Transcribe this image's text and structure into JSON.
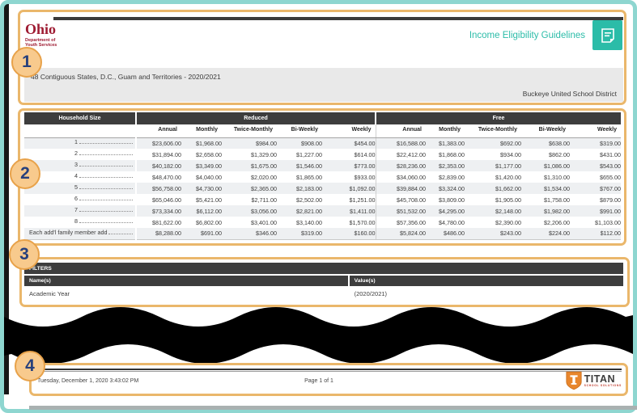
{
  "colors": {
    "teal_accent": "#2bbca8",
    "header_bar": "#3d3d3d",
    "frame_border": "#8ed6d0",
    "annotation_border": "#eab76b",
    "annotation_circle_fill": "#f8ca8d",
    "annotation_number": "#27407c",
    "ohio_red": "#9e1b32",
    "titan_orange": "#e8862d",
    "titan_sub_red": "#c0392b",
    "row_stripe": "#eef0f2"
  },
  "icons": {
    "report_icon": "document-icon",
    "brand_icon": "shield-icon"
  },
  "header": {
    "logo_title": "Ohio",
    "logo_sub1": "Department of",
    "logo_sub2": "Youth Services",
    "report_title": "Income Eligibility Guidelines",
    "region_line": "48 Contiguous States, D.C., Guam and Territories - 2020/2021",
    "district": "Buckeye United School District"
  },
  "table": {
    "household_header": "Household Size",
    "group_headers": [
      "Reduced",
      "Free"
    ],
    "sub_headers": [
      "Annual",
      "Monthly",
      "Twice-Monthly",
      "Bi-Weekly",
      "Weekly"
    ],
    "rows": [
      {
        "label": "1",
        "values": [
          "$23,606.00",
          "$1,968.00",
          "$984.00",
          "$908.00",
          "$454.00",
          "$16,588.00",
          "$1,383.00",
          "$692.00",
          "$638.00",
          "$319.00"
        ]
      },
      {
        "label": "2",
        "values": [
          "$31,894.00",
          "$2,658.00",
          "$1,329.00",
          "$1,227.00",
          "$614.00",
          "$22,412.00",
          "$1,868.00",
          "$934.00",
          "$862.00",
          "$431.00"
        ]
      },
      {
        "label": "3",
        "values": [
          "$40,182.00",
          "$3,349.00",
          "$1,675.00",
          "$1,546.00",
          "$773.00",
          "$28,236.00",
          "$2,353.00",
          "$1,177.00",
          "$1,086.00",
          "$543.00"
        ]
      },
      {
        "label": "4",
        "values": [
          "$48,470.00",
          "$4,040.00",
          "$2,020.00",
          "$1,865.00",
          "$933.00",
          "$34,060.00",
          "$2,839.00",
          "$1,420.00",
          "$1,310.00",
          "$655.00"
        ]
      },
      {
        "label": "5",
        "values": [
          "$56,758.00",
          "$4,730.00",
          "$2,365.00",
          "$2,183.00",
          "$1,092.00",
          "$39,884.00",
          "$3,324.00",
          "$1,662.00",
          "$1,534.00",
          "$767.00"
        ]
      },
      {
        "label": "6",
        "values": [
          "$65,046.00",
          "$5,421.00",
          "$2,711.00",
          "$2,502.00",
          "$1,251.00",
          "$45,708.00",
          "$3,809.00",
          "$1,905.00",
          "$1,758.00",
          "$879.00"
        ]
      },
      {
        "label": "7",
        "values": [
          "$73,334.00",
          "$6,112.00",
          "$3,056.00",
          "$2,821.00",
          "$1,411.00",
          "$51,532.00",
          "$4,295.00",
          "$2,148.00",
          "$1,982.00",
          "$991.00"
        ]
      },
      {
        "label": "8",
        "values": [
          "$81,622.00",
          "$6,802.00",
          "$3,401.00",
          "$3,140.00",
          "$1,570.00",
          "$57,356.00",
          "$4,780.00",
          "$2,390.00",
          "$2,206.00",
          "$1,103.00"
        ]
      },
      {
        "label": "Each add'l family member add",
        "values": [
          "$8,288.00",
          "$691.00",
          "$346.00",
          "$319.00",
          "$160.00",
          "$5,824.00",
          "$486.00",
          "$243.00",
          "$224.00",
          "$112.00"
        ]
      }
    ]
  },
  "filters": {
    "title": "FILTERS",
    "name_header": "Name(s)",
    "value_header": "Value(s)",
    "rows": [
      {
        "name": "Academic Year",
        "value": "(2020/2021)"
      }
    ]
  },
  "footer": {
    "timestamp": "Tuesday, December 1, 2020 3:43:02 PM",
    "page_label": "Page 1 of 1",
    "brand": "TITAN",
    "brand_sub": "SCHOOL SOLUTIONS"
  },
  "annotations": [
    "1",
    "2",
    "3",
    "4"
  ]
}
